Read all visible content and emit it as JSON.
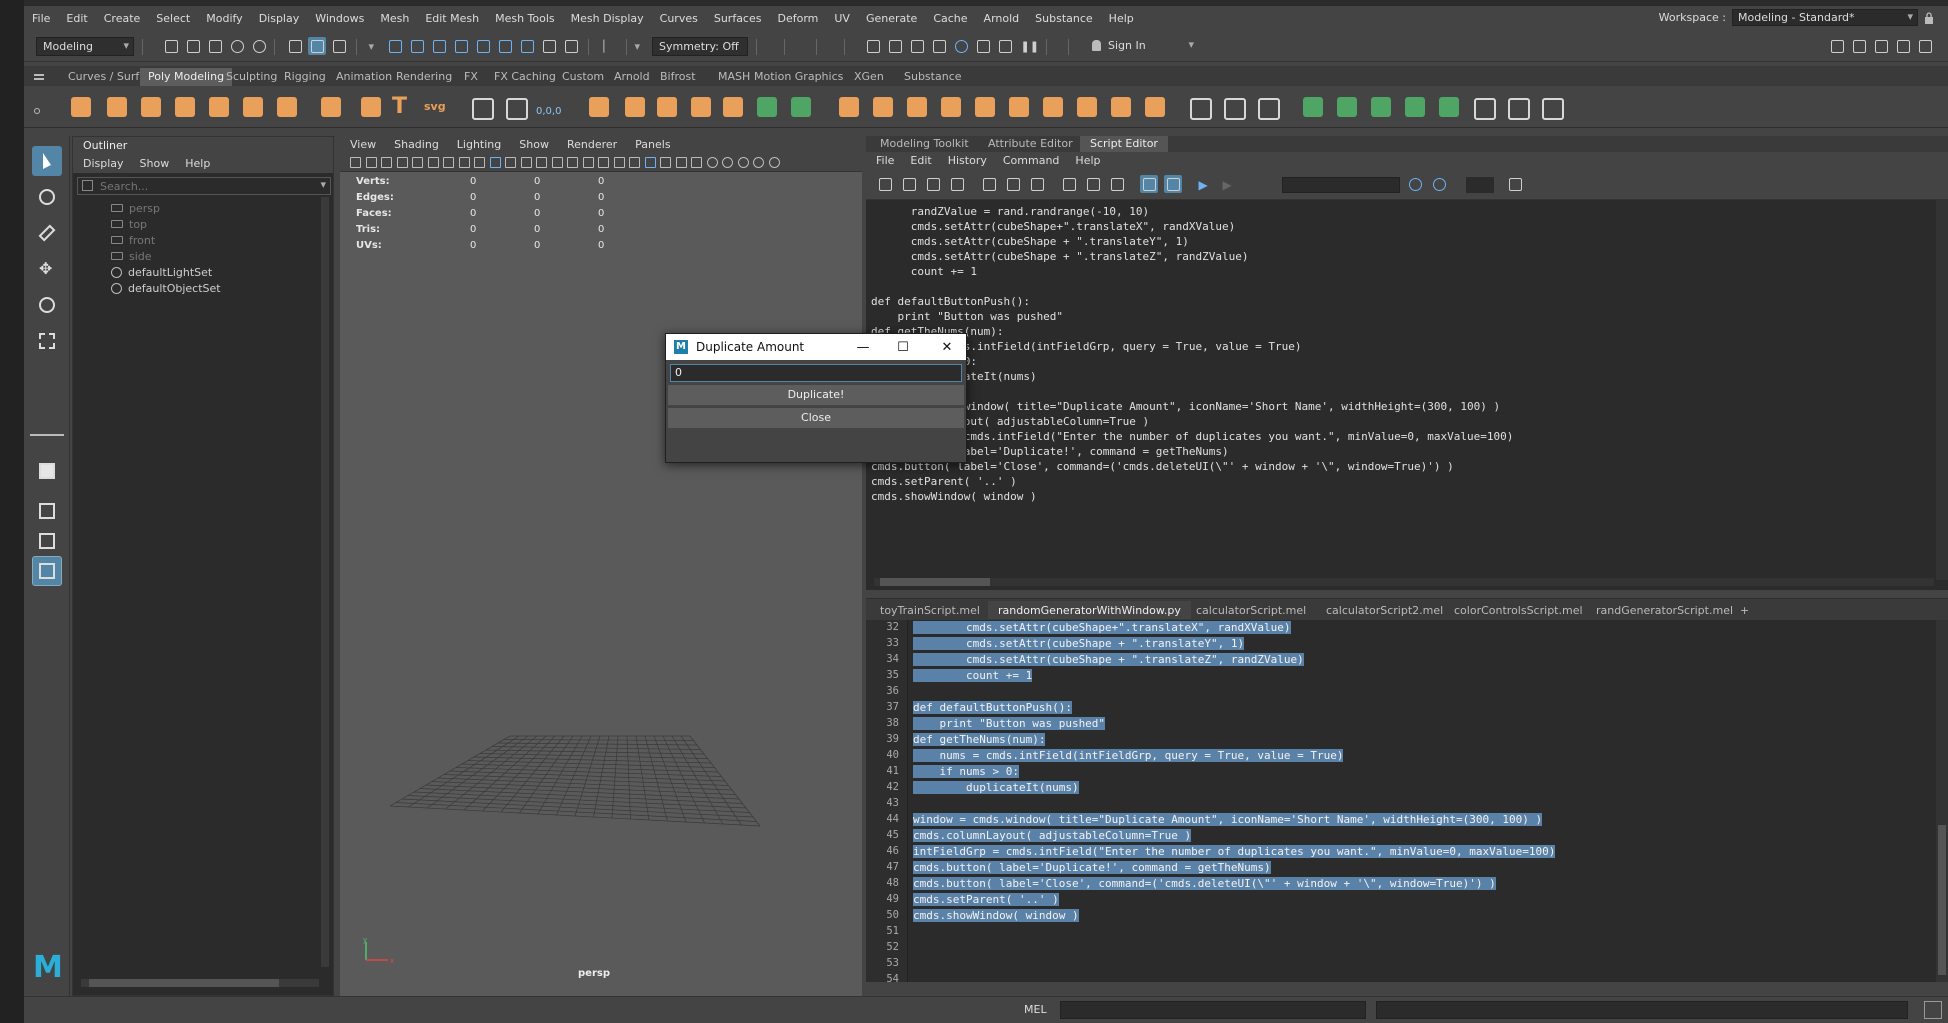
{
  "menubar": {
    "items": [
      "File",
      "Edit",
      "Create",
      "Select",
      "Modify",
      "Display",
      "Windows",
      "Mesh",
      "Edit Mesh",
      "Mesh Tools",
      "Mesh Display",
      "Curves",
      "Surfaces",
      "Deform",
      "UV",
      "Generate",
      "Cache",
      "Arnold",
      "Substance",
      "Help"
    ],
    "workspace_label": "Workspace :",
    "workspace_value": "Modeling - Standard*"
  },
  "statusline": {
    "mode": "Modeling",
    "symmetry": "Symmetry: Off",
    "sign_in": "Sign In"
  },
  "shelf": {
    "tabs": [
      "Curves / Surfaces",
      "Poly Modeling",
      "Sculpting",
      "Rigging",
      "Animation",
      "Rendering",
      "FX",
      "FX Caching",
      "Custom",
      "Arnold",
      "Bifrost",
      "MASH",
      "Motion Graphics",
      "XGen",
      "Substance"
    ],
    "active_tab": "Poly Modeling",
    "text_icon_label": "T",
    "svg_icon_label": "svg",
    "coord_label": "0,0,0"
  },
  "outliner": {
    "title": "Outliner",
    "menu": [
      "Display",
      "Show",
      "Help"
    ],
    "search_placeholder": "Search...",
    "items": [
      {
        "label": "persp",
        "dim": true
      },
      {
        "label": "top",
        "dim": true
      },
      {
        "label": "front",
        "dim": true
      },
      {
        "label": "side",
        "dim": true
      },
      {
        "label": "defaultLightSet",
        "dim": false
      },
      {
        "label": "defaultObjectSet",
        "dim": false
      }
    ]
  },
  "viewport": {
    "menu": [
      "View",
      "Shading",
      "Lighting",
      "Show",
      "Renderer",
      "Panels"
    ],
    "hud": [
      {
        "label": "Verts:",
        "v1": "0",
        "v2": "0",
        "v3": "0"
      },
      {
        "label": "Edges:",
        "v1": "0",
        "v2": "0",
        "v3": "0"
      },
      {
        "label": "Faces:",
        "v1": "0",
        "v2": "0",
        "v3": "0"
      },
      {
        "label": "Tris:",
        "v1": "0",
        "v2": "0",
        "v3": "0"
      },
      {
        "label": "UVs:",
        "v1": "0",
        "v2": "0",
        "v3": "0"
      }
    ],
    "camera": "persp"
  },
  "right_panel": {
    "tabs": [
      "Modeling Toolkit",
      "Attribute Editor",
      "Script Editor"
    ],
    "active_tab": "Script Editor",
    "menu": [
      "File",
      "Edit",
      "History",
      "Command",
      "Help"
    ]
  },
  "history_lines": [
    "      randZValue = rand.randrange(-10, 10)",
    "      cmds.setAttr(cubeShape+\".translateX\", randXValue)",
    "      cmds.setAttr(cubeShape + \".translateY\", 1)",
    "      cmds.setAttr(cubeShape + \".translateZ\", randZValue)",
    "      count += 1",
    "",
    "def defaultButtonPush():",
    "    print \"Button was pushed\"",
    "def getTheNums(num):",
    "    nums = cmds.intField(intFieldGrp, query = True, value = True)",
    "    if nums > 0:",
    "        duplicateIt(nums)",
    "",
    "window = cmds.window( title=\"Duplicate Amount\", iconName='Short Name', widthHeight=(300, 100) )",
    "cmds.columnLayout( adjustableColumn=True )",
    "intFieldGrp = cmds.intField(\"Enter the number of duplicates you want.\", minValue=0, maxValue=100)",
    "cmds.button( label='Duplicate!', command = getTheNums)",
    "cmds.button( label='Close', command=('cmds.deleteUI(\\\"' + window + '\\\", window=True)') )",
    "cmds.setParent( '..' )",
    "cmds.showWindow( window )"
  ],
  "editor_tabs": [
    "toyTrainScript.mel",
    "randomGeneratorWithWindow.py",
    "calculatorScript.mel",
    "calculatorScript2.mel",
    "colorControlsScript.mel",
    "randGeneratorScript.mel",
    "+"
  ],
  "editor_active_tab": "randomGeneratorWithWindow.py",
  "editor_lines": [
    {
      "n": "32",
      "t": "        cmds.setAttr(cubeShape+\".translateX\", randXValue)"
    },
    {
      "n": "33",
      "t": "        cmds.setAttr(cubeShape + \".translateY\", 1)"
    },
    {
      "n": "34",
      "t": "        cmds.setAttr(cubeShape + \".translateZ\", randZValue)"
    },
    {
      "n": "35",
      "t": "        count += 1"
    },
    {
      "n": "36",
      "t": ""
    },
    {
      "n": "37",
      "t": "def defaultButtonPush():"
    },
    {
      "n": "38",
      "t": "    print \"Button was pushed\""
    },
    {
      "n": "39",
      "t": "def getTheNums(num):"
    },
    {
      "n": "40",
      "t": "    nums = cmds.intField(intFieldGrp, query = True, value = True)"
    },
    {
      "n": "41",
      "t": "    if nums > 0:"
    },
    {
      "n": "42",
      "t": "        duplicateIt(nums)"
    },
    {
      "n": "43",
      "t": ""
    },
    {
      "n": "44",
      "t": "window = cmds.window( title=\"Duplicate Amount\", iconName='Short Name', widthHeight=(300, 100) )"
    },
    {
      "n": "45",
      "t": "cmds.columnLayout( adjustableColumn=True )"
    },
    {
      "n": "46",
      "t": "intFieldGrp = cmds.intField(\"Enter the number of duplicates you want.\", minValue=0, maxValue=100)"
    },
    {
      "n": "47",
      "t": "cmds.button( label='Duplicate!', command = getTheNums)"
    },
    {
      "n": "48",
      "t": "cmds.button( label='Close', command=('cmds.deleteUI(\\\"' + window + '\\\", window=True)') )"
    },
    {
      "n": "49",
      "t": "cmds.setParent( '..' )"
    },
    {
      "n": "50",
      "t": "cmds.showWindow( window )"
    },
    {
      "n": "51",
      "t": ""
    },
    {
      "n": "52",
      "t": ""
    },
    {
      "n": "53",
      "t": ""
    },
    {
      "n": "54",
      "t": ""
    }
  ],
  "cmdline": {
    "lang": "MEL"
  },
  "dialog": {
    "title": "Duplicate Amount",
    "logo": "M",
    "field_value": "0",
    "duplicate_label": "Duplicate!",
    "close_label": "Close",
    "minimize_glyph": "—",
    "maximize_glyph": "☐",
    "close_glyph": "✕"
  },
  "colors": {
    "accent": "#5285a6",
    "selection": "#5a82a8",
    "shelf_orange": "#e8a05a",
    "shelf_green": "#4ea564",
    "logo": "#2ab0d8"
  },
  "axis_labels": {
    "y": "y",
    "x": "x"
  },
  "icon_names": [
    "select-tool-icon",
    "lasso-tool-icon",
    "paint-select-icon",
    "move-tool-icon",
    "rotate-tool-icon",
    "scale-tool-icon",
    "layout-icon"
  ]
}
